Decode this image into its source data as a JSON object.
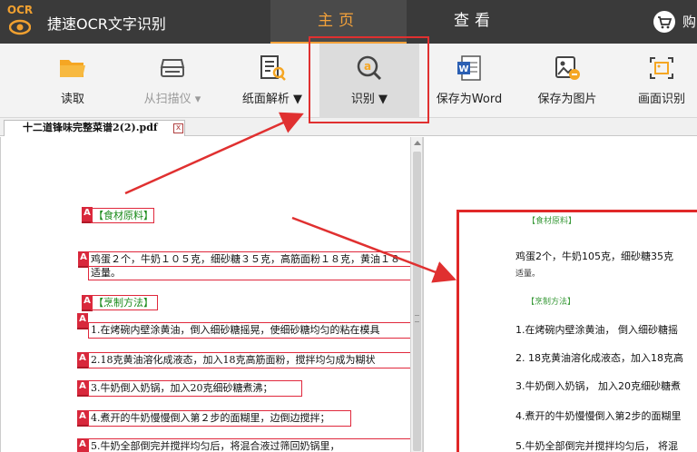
{
  "app": {
    "logo_text": "OCR",
    "title": "捷速OCR文字识别",
    "top_tabs": [
      {
        "label": "主页",
        "active": true
      },
      {
        "label": "查看",
        "active": false
      }
    ],
    "cart_label": "购"
  },
  "toolbar": {
    "items": [
      {
        "label": "读取",
        "icon": "folder-icon",
        "disabled": false
      },
      {
        "label": "从扫描仪 ▾",
        "icon": "scanner-icon",
        "disabled": true
      },
      {
        "label": "纸面解析 ▼",
        "icon": "page-analyze-icon",
        "disabled": false
      },
      {
        "label": "识别 ▼",
        "icon": "recognize-icon",
        "disabled": false,
        "selected": true
      },
      {
        "label": "保存为Word",
        "icon": "word-icon",
        "disabled": false
      },
      {
        "label": "保存为图片",
        "icon": "save-image-icon",
        "disabled": false
      },
      {
        "label": "画面识别",
        "icon": "screen-capture-icon",
        "disabled": false
      }
    ]
  },
  "document_tab": {
    "filename": "十二道锋味完整菜谱2(2).pdf",
    "close": "x"
  },
  "left_document": {
    "marker": "A",
    "regions": [
      {
        "text": "【食材原料】",
        "green": true
      },
      {
        "text": "鸡蛋２个，牛奶１０５克，细砂糖３５克，高筋面粉１８克，黄油１８",
        "green": false
      },
      {
        "text": "适量。",
        "green": false
      },
      {
        "text": "【烹制方法】",
        "green": true
      },
      {
        "text": "1.在烤碗内壁涂黄油，倒入细砂糖摇晃，使细砂糖均匀的粘在模具",
        "green": false
      },
      {
        "text": "2.18克黄油溶化成液态，加入18克高筋面粉，搅拌均匀成为糊状",
        "green": false
      },
      {
        "text": "3.牛奶倒入奶锅，加入20克细砂糖煮沸；",
        "green": false
      },
      {
        "text": "4.煮开的牛奶慢慢倒入第２步的面糊里，边倒边搅拌；",
        "green": false
      },
      {
        "text": "5.牛奶全部倒完并搅拌均匀后，将混合液过筛回奶锅里，",
        "green": false
      }
    ]
  },
  "right_result": {
    "lines": [
      {
        "text": "【食材原料】",
        "style": "green"
      },
      {
        "text": "鸡蛋2个，牛奶105克，细砂糖35克",
        "style": "normal"
      },
      {
        "text": "适量。",
        "style": "small"
      },
      {
        "text": "【烹制方法】",
        "style": "green"
      },
      {
        "text": "1.在烤碗内壁涂黄油，  倒入细砂糖摇",
        "style": "normal"
      },
      {
        "text": "2.  18克黄油溶化成液态，加入18克高",
        "style": "normal"
      },
      {
        "text": "3.牛奶倒入奶锅，  加入20克细砂糖煮",
        "style": "normal"
      },
      {
        "text": "4.煮开的牛奶慢慢倒入第2步的面糊里",
        "style": "normal"
      },
      {
        "text": "5.牛奶全部倒完并搅拌均匀后，  将混",
        "style": "normal"
      }
    ]
  },
  "colors": {
    "titlebar": "#3a3a3a",
    "accent": "#f3a13a",
    "highlight": "#e03030",
    "region_border": "#e0283c",
    "heading_green": "#1a8a1a"
  }
}
